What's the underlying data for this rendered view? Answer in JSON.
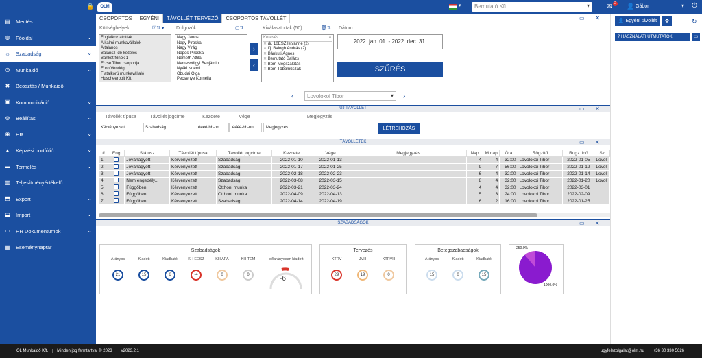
{
  "topbar": {
    "logo": "OLM",
    "company": "Bemutató Kft.",
    "mail_count": "2",
    "user": "Gábor"
  },
  "sidebar": {
    "items": [
      {
        "label": "Mentés",
        "icon": "save-icon"
      },
      {
        "label": "Főoldal",
        "icon": "globe-icon"
      },
      {
        "label": "Szabadság",
        "icon": "sun-icon"
      },
      {
        "label": "Munkaidő",
        "icon": "clock-icon"
      },
      {
        "label": "Beosztás / Munkaidő",
        "icon": "tools-icon"
      },
      {
        "label": "Kommunikáció",
        "icon": "chat-icon"
      },
      {
        "label": "Beállítás",
        "icon": "gears-icon"
      },
      {
        "label": "HR",
        "icon": "users-icon"
      },
      {
        "label": "Képzési portfólió",
        "icon": "graduation-icon"
      },
      {
        "label": "Termelés",
        "icon": "truck-icon"
      },
      {
        "label": "Teljesítményértékelő",
        "icon": "chart-icon"
      },
      {
        "label": "Export",
        "icon": "export-icon"
      },
      {
        "label": "Import",
        "icon": "import-icon"
      },
      {
        "label": "HR Dokumentumok",
        "icon": "folder-icon"
      },
      {
        "label": "Eseménynaptár",
        "icon": "calendar-icon"
      }
    ]
  },
  "tabs": [
    "CSOPORTOS",
    "EGYÉNI",
    "TÁVOLLÉT TERVEZŐ",
    "CSOPORTOS TÁVOLLÉT"
  ],
  "filters": {
    "koltseghelyek_label": "Költséghelyek",
    "koltseghelyek": [
      "Foglalkoztatottak",
      "Alkalmi munkavállalók",
      "Általános",
      "Balansz idő kezelés",
      "Banket főnök 1",
      "Erzse Tibor csoportja",
      "Euro Vendég",
      "Fiatalkorú munkavállaló",
      "Huscheerbolt Kft."
    ],
    "dolgozok_label": "Dolgozók",
    "dolgozok": [
      "Nagy János",
      "Nagy Piroska",
      "Nagy Virág",
      "Napos Piroska",
      "Németh Attila",
      "Nemesvölgyi Benjámin",
      "Nyéki Noémi",
      "Obudai Olga",
      "Pecsenye Kornélia"
    ],
    "kivalasztottak_label": "Kiválasztottak (50)",
    "search_placeholder": "Keresés...",
    "kivalasztottak": [
      "dr. 10ESZ Istvánné (2)",
      "ifj. Balogh András (2)",
      "Bánkuti Ágnes",
      "Bemutató Balázs",
      "Bom Megszakítás",
      "Bom Többműszak"
    ],
    "datum_label": "Dátum",
    "datum_value": "2022. jan. 01. - 2022. dec. 31.",
    "szures_label": "SZŰRÉS"
  },
  "person_select": "Lovolokoi Tibor",
  "uj_tavollet": {
    "title": "ÚJ TÁVOLLÉT",
    "headers": [
      "Távollét típusa",
      "Távollét jogcíme",
      "Kezdete",
      "Vége",
      "Megjegyzés"
    ],
    "tipus": "Kérvényezett",
    "jogcim": "Szabadság",
    "kezdete": "éééé-hh-nn",
    "vege": "éééé-hh-nn",
    "megjegyzes": "Megjegyzés",
    "letrehozas": "LÉTREHOZÁS"
  },
  "tavolletek": {
    "title": "TÁVOLLÉTEK",
    "headers": [
      "#",
      "Eng",
      "Státusz",
      "Távollét típusa",
      "Távollét jogcíme",
      "Kezdete",
      "Vége",
      "Megjegyzés",
      "Nap",
      "M nap",
      "Óra",
      "Rögzítő",
      "Rogz. idő",
      "Sz"
    ],
    "rows": [
      [
        "1",
        "Jóváhagyott",
        "Kérvényezett",
        "Szabadság",
        "2022-01-10",
        "2022-01-13",
        "",
        "4",
        "4",
        "32:00",
        "Lovolokoi Tibor",
        "2022-01-05",
        "Lovol"
      ],
      [
        "2",
        "Jóváhagyott",
        "Kérvényezett",
        "Szabadság",
        "2022-01-17",
        "2022-01-25",
        "",
        "9",
        "7",
        "56:00",
        "Lovolokoi Tibor",
        "2022-01-12",
        "Lovol"
      ],
      [
        "3",
        "Jóváhagyott",
        "Kérvényezett",
        "Szabadság",
        "2022-02-18",
        "2022-02-23",
        "",
        "6",
        "4",
        "32:00",
        "Lovolokoi Tibor",
        "2022-01-14",
        "Lovol"
      ],
      [
        "4",
        "Nem engedély...",
        "Kérvényezett",
        "Szabadság",
        "2022-03-08",
        "2022-03-15",
        "",
        "8",
        "4",
        "32:00",
        "Lovolokoi Tibor",
        "2022-01-20",
        "Lovol"
      ],
      [
        "5",
        "Függőben",
        "Kérvényezett",
        "Otthoni munka",
        "2022-03-21",
        "2022-03-24",
        "",
        "4",
        "4",
        "32:00",
        "Lovolokoi Tibor",
        "2022-03-01",
        ""
      ],
      [
        "6",
        "Függőben",
        "Kérvényezett",
        "Otthoni munka",
        "2022-04-09",
        "2022-04-13",
        "",
        "5",
        "3",
        "24:00",
        "Lovolokoi Tibor",
        "2022-02-09",
        ""
      ],
      [
        "7",
        "Függőben",
        "Kérvényezett",
        "Szabadság",
        "2022-04-14",
        "2022-04-19",
        "",
        "6",
        "2",
        "16:00",
        "Lovolokoi Tibor",
        "2022-01-25",
        ""
      ]
    ]
  },
  "szabadsagok": {
    "title": "SZABADSÁGOK",
    "card1": {
      "title": "Szabadságok",
      "items": [
        {
          "label": "Arányos",
          "value": "21",
          "color": "#1b4fa0"
        },
        {
          "label": "Kiadott",
          "value": "15",
          "color": "#1b4fa0"
        },
        {
          "label": "Kiadható",
          "value": "6",
          "color": "#1b4fa0"
        },
        {
          "label": "KH EESZ",
          "value": "-4",
          "color": "#d9352b"
        },
        {
          "label": "KH APA",
          "value": "0",
          "color": "#f0c9a0"
        },
        {
          "label": "KH TEM",
          "value": "0",
          "color": "#ccc"
        }
      ],
      "gauge_label": "Időarányosan kiadott",
      "gauge_value": "-6"
    },
    "card2": {
      "title": "Tervezés",
      "items": [
        {
          "label": "KTRV",
          "value": "29",
          "color": "#d9352b"
        },
        {
          "label": "JVH",
          "value": "19",
          "color": "#f0b878"
        },
        {
          "label": "KTRVH",
          "value": "0",
          "color": "#f0c9a0"
        }
      ]
    },
    "card3": {
      "title": "Betegszabadságok",
      "items": [
        {
          "label": "Arányos",
          "value": "15",
          "color": "#cde"
        },
        {
          "label": "Kiadott",
          "value": "0",
          "color": "#cde"
        },
        {
          "label": "Kiadható",
          "value": "15",
          "color": "#7ab"
        }
      ]
    },
    "pie": {
      "top_label": "250.0%",
      "bottom_label": "1000.0%"
    }
  },
  "right_panel": {
    "egyeni_tavollet": "Egyéni távollét",
    "hasznalati": "HASZNÁLATI ÚTMUTATÓK"
  },
  "footer": {
    "company": "OL Munkaidő Kft.",
    "rights": "Minden jog fenntartva. © 2023",
    "version": "v2023.2.1",
    "email": "ugyfelszolgalat@olm.hu",
    "phone": "+36 30 330 5626"
  }
}
